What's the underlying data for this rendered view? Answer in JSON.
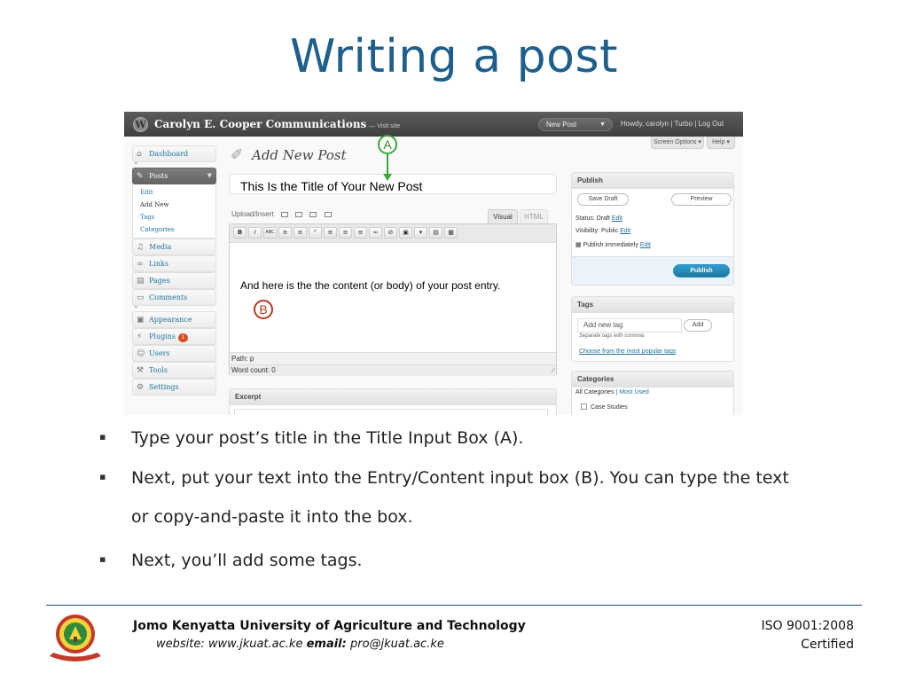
{
  "slide": {
    "title": "Writing a post"
  },
  "wp": {
    "site_title": "Carolyn E. Cooper Communications",
    "visit_site": "— Visit site",
    "new_post_btn": "New Post",
    "user_links": "Howdy, carolyn | Turbo | Log Out",
    "screen_options": "Screen Options ▾",
    "help": "Help ▾",
    "menu": {
      "dashboard": "Dashboard",
      "posts": "Posts",
      "posts_sub": [
        "Edit",
        "Add New",
        "Tags",
        "Categories"
      ],
      "media": "Media",
      "links": "Links",
      "pages": "Pages",
      "comments": "Comments",
      "appearance": "Appearance",
      "plugins": "Plugins",
      "plugins_badge": "1",
      "users": "Users",
      "tools": "Tools",
      "settings": "Settings"
    },
    "page_heading": "Add New Post",
    "post_title": "This Is the Title of Your New Post",
    "upload_insert": "Upload/Insert",
    "tab_visual": "Visual",
    "tab_html": "HTML",
    "toolbar": [
      "B",
      "I",
      "ABC",
      "≡",
      "≡",
      "“",
      "≡",
      "≡",
      "≡",
      "∞",
      "⊘",
      "▣",
      "▾",
      "▤",
      "▦"
    ],
    "content": "And here is the the content (or body) of your post entry.",
    "path": "Path: p",
    "word_count": "Word count: 0",
    "excerpt_title": "Excerpt",
    "publish": {
      "title": "Publish",
      "save_draft": "Save Draft",
      "preview": "Preview",
      "status_label": "Status: Draft",
      "visibility_label": "Visibility: Public",
      "schedule_label": "Publish immediately",
      "edit": "Edit",
      "publish_btn": "Publish"
    },
    "tags": {
      "title": "Tags",
      "placeholder": "Add new tag",
      "add": "Add",
      "hint": "Separate tags with commas",
      "choose": "Choose from the most popular tags"
    },
    "categories": {
      "title": "Categories",
      "all": "All Categories",
      "divider": "|",
      "most_used": "Most Used",
      "item": "Case Studies"
    }
  },
  "markers": {
    "a": "A",
    "b": "B"
  },
  "bullets": [
    "Type your post’s title in the Title Input Box (A).",
    "Next, put your text into the Entry/Content input box (B). You can type the text",
    "or copy-and-paste it into the box.",
    "Next, you’ll add some tags."
  ],
  "bullet_glyph": "▪",
  "footer": {
    "org": "Jomo Kenyatta University of Agriculture and Technology",
    "website_label": "website:",
    "website": "www.jkuat.ac.ke",
    "email_label": "email:",
    "email": "pro@jkuat.ac.ke",
    "iso": "ISO 9001:2008",
    "certified": "Certified"
  },
  "colors": {
    "title": "#1f5f8b",
    "marker_a": "#3aa637",
    "marker_b": "#b23a23",
    "wp_link": "#21759b",
    "publish_btn": "#21759b"
  }
}
